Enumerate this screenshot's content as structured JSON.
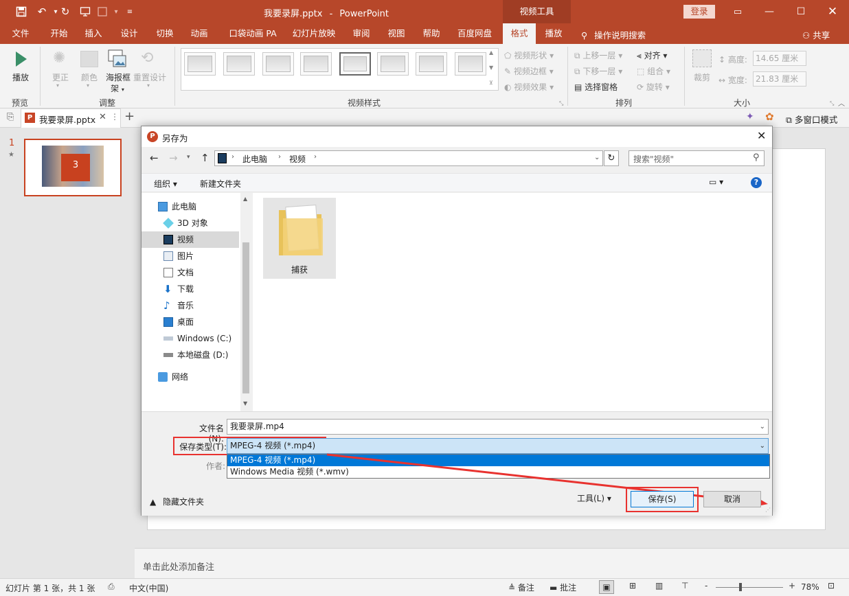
{
  "app": {
    "doc_title": "我要录屏.pptx",
    "separator": "-",
    "app_name": "PowerPoint",
    "context_tab": "视频工具",
    "login": "登录",
    "accent": "#b7472a"
  },
  "menu": {
    "items": [
      "文件",
      "开始",
      "插入",
      "设计",
      "切换",
      "动画",
      "口袋动画 PA",
      "幻灯片放映",
      "审阅",
      "视图",
      "帮助",
      "百度网盘",
      "格式",
      "播放"
    ],
    "tell_me": "操作说明搜索",
    "share": "共享"
  },
  "ribbon": {
    "play": "播放",
    "preview": "预览",
    "correct": "更正",
    "color": "颜色",
    "poster_frame": "海报框",
    "poster_frame2": "架",
    "reset": "重置设计",
    "adjust": "调整",
    "video_styles": "视频样式",
    "video_shape": "视频形状",
    "video_border": "视频边框",
    "video_effects": "视频效果",
    "bring_forward": "上移一层",
    "send_backward": "下移一层",
    "selection_pane": "选择窗格",
    "align": "对齐",
    "group": "组合",
    "rotate": "旋转",
    "arrange": "排列",
    "crop": "裁剪",
    "height_label": "高度:",
    "height_value": "14.65 厘米",
    "width_label": "宽度:",
    "width_value": "21.83 厘米",
    "size": "大小"
  },
  "tabs": {
    "file_tab": "我要录屏.pptx",
    "multiwindow": "多窗口模式"
  },
  "slides": {
    "number": "1",
    "star": "★",
    "thumb_number": "3"
  },
  "notes_placeholder": "单击此处添加备注",
  "dialog": {
    "title": "另存为",
    "address": {
      "this_pc": "此电脑",
      "folder": "视频"
    },
    "search_placeholder": "搜索\"视频\"",
    "toolbar": {
      "organize": "组织",
      "new_folder": "新建文件夹"
    },
    "nav": [
      "此电脑",
      "3D 对象",
      "视频",
      "图片",
      "文档",
      "下载",
      "音乐",
      "桌面",
      "Windows (C:)",
      "本地磁盘 (D:)",
      "网络"
    ],
    "files": [
      {
        "name": "捕获"
      }
    ],
    "filename_label": "文件名(N):",
    "filename_value": "我要录屏.mp4",
    "type_label": "保存类型(T):",
    "type_value": "MPEG-4 视频 (*.mp4)",
    "author_label": "作者:",
    "type_options": [
      "MPEG-4 视频 (*.mp4)",
      "Windows Media 视频 (*.wmv)"
    ],
    "hide_folders": "隐藏文件夹",
    "tools": "工具(L)",
    "save": "保存(S)",
    "cancel": "取消"
  },
  "status": {
    "slide_info": "幻灯片 第 1 张，共 1 张",
    "language": "中文(中国)",
    "notes": "备注",
    "comments": "批注",
    "zoom": "78%",
    "zoom_minus": "-",
    "zoom_plus": "+"
  }
}
